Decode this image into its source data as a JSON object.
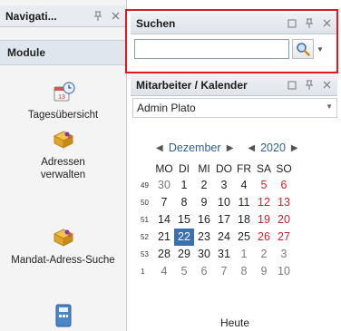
{
  "nav": {
    "title": "Navigati...",
    "module_label": "Module",
    "items": [
      {
        "label": "Tagesübersicht",
        "icon": "calendar-clock-icon"
      },
      {
        "label": "Adressen verwalten",
        "icon": "address-book-icon"
      },
      {
        "label": "Mandat-Adress-Suche",
        "icon": "mandate-address-icon"
      },
      {
        "label": "",
        "icon": "calculator-icon"
      }
    ]
  },
  "search": {
    "title": "Suchen",
    "value": "",
    "placeholder": ""
  },
  "calendar_pane": {
    "title": "Mitarbeiter / Kalender",
    "employee": "Admin Plato",
    "month": "Dezember",
    "year": "2020",
    "weekdays": [
      "MO",
      "DI",
      "MI",
      "DO",
      "FR",
      "SA",
      "SO"
    ],
    "weeks": [
      {
        "cw": "49",
        "days": [
          "30",
          "1",
          "2",
          "3",
          "4",
          "5",
          "6"
        ]
      },
      {
        "cw": "50",
        "days": [
          "7",
          "8",
          "9",
          "10",
          "11",
          "12",
          "13"
        ]
      },
      {
        "cw": "51",
        "days": [
          "14",
          "15",
          "16",
          "17",
          "18",
          "19",
          "20"
        ]
      },
      {
        "cw": "52",
        "days": [
          "21",
          "22",
          "23",
          "24",
          "25",
          "26",
          "27"
        ]
      },
      {
        "cw": "53",
        "days": [
          "28",
          "29",
          "30",
          "31",
          "1",
          "2",
          "3"
        ]
      },
      {
        "cw": "1",
        "days": [
          "4",
          "5",
          "6",
          "7",
          "8",
          "9",
          "10"
        ]
      }
    ],
    "selected_day": "22",
    "today_label": "Heute"
  },
  "colors": {
    "accent": "#3a6fb0",
    "highlight_border": "#e5161e",
    "weekend": "#d0202e"
  }
}
